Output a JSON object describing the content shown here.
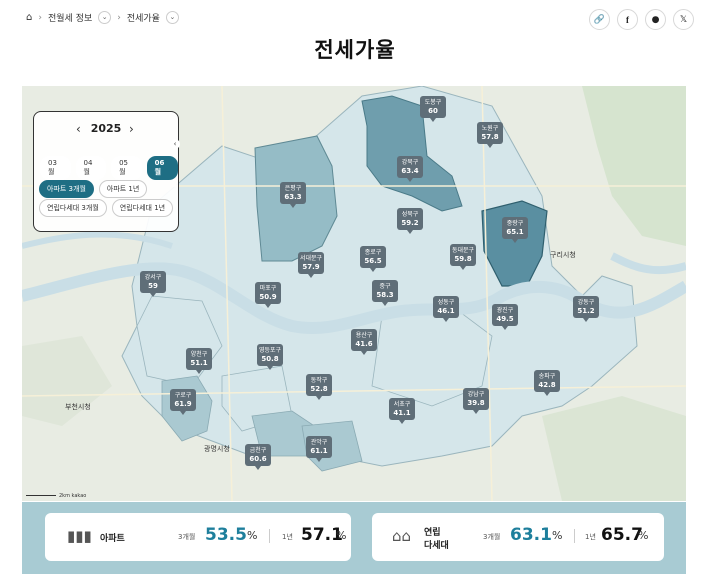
{
  "breadcrumb": {
    "home_icon": "home-icon",
    "level1": "전월세 정보",
    "level2": "전세가율"
  },
  "page_title": "전세가율",
  "share": [
    "link-icon",
    "facebook-icon",
    "chat-icon",
    "x-icon"
  ],
  "panel": {
    "year": "2025",
    "months": [
      "03월",
      "04월",
      "05월",
      "06월"
    ],
    "selected_month": "06월",
    "types": [
      "아파트 3개월",
      "아파트 1년",
      "연립다세대 3개월",
      "연립다세대 1년"
    ],
    "selected_type": "아파트 3개월"
  },
  "districts": [
    {
      "name": "도봉구",
      "value": "60"
    },
    {
      "name": "노원구",
      "value": "57.8"
    },
    {
      "name": "강북구",
      "value": "63.4"
    },
    {
      "name": "은평구",
      "value": "63.3"
    },
    {
      "name": "성북구",
      "value": "59.2"
    },
    {
      "name": "중랑구",
      "value": "65.1"
    },
    {
      "name": "동대문구",
      "value": "59.8"
    },
    {
      "name": "종로구",
      "value": "56.5"
    },
    {
      "name": "서대문구",
      "value": "57.9"
    },
    {
      "name": "강서구",
      "value": "59"
    },
    {
      "name": "마포구",
      "value": "50.9"
    },
    {
      "name": "중구",
      "value": "58.3"
    },
    {
      "name": "성동구",
      "value": "46.1"
    },
    {
      "name": "광진구",
      "value": "49.5"
    },
    {
      "name": "강동구",
      "value": "51.2"
    },
    {
      "name": "용산구",
      "value": "41.6"
    },
    {
      "name": "양천구",
      "value": "51.1"
    },
    {
      "name": "영등포구",
      "value": "50.8"
    },
    {
      "name": "동작구",
      "value": "52.8"
    },
    {
      "name": "구로구",
      "value": "61.9"
    },
    {
      "name": "서초구",
      "value": "41.1"
    },
    {
      "name": "강남구",
      "value": "39.8"
    },
    {
      "name": "송파구",
      "value": "42.8"
    },
    {
      "name": "금천구",
      "value": "60.6"
    },
    {
      "name": "관악구",
      "value": "61.1"
    }
  ],
  "map_labels": [
    "구리시청",
    "광명시청",
    "부천시청"
  ],
  "scale_label": "2km",
  "map_attribution": "kakao",
  "stats": {
    "apartment": {
      "label": "아파트",
      "m3_label": "3개월",
      "m3_value": "53.5",
      "y1_label": "1년",
      "y1_value": "57.1",
      "unit": "%"
    },
    "villa": {
      "label_line1": "연립",
      "label_line2": "다세대",
      "m3_label": "3개월",
      "m3_value": "63.1",
      "y1_label": "1년",
      "y1_value": "65.7",
      "unit": "%"
    }
  },
  "colors": {
    "accent": "#1e7f9c",
    "dark_fill": "#5a8fa1",
    "mid_fill": "#95bcc6",
    "light_fill": "#d5e6ea",
    "stats_bg": "#a8cbd3"
  }
}
